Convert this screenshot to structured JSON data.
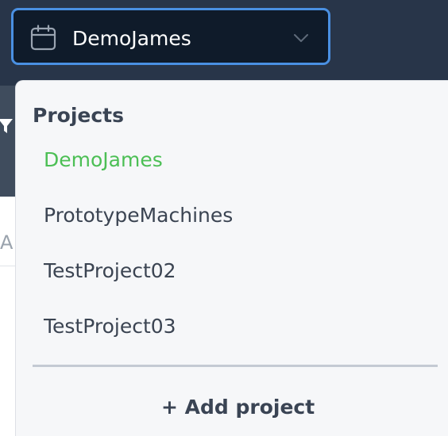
{
  "project_select": {
    "selected_value": "DemoJames",
    "icon": "calendar-icon",
    "chevron": "chevron-down-icon"
  },
  "background": {
    "letter_fragment": "A",
    "filter_icon": "filter-icon"
  },
  "dropdown": {
    "heading": "Projects",
    "items": [
      {
        "label": "DemoJames",
        "active": true
      },
      {
        "label": "PrototypeMachines",
        "active": false
      },
      {
        "label": "TestProject02",
        "active": false
      },
      {
        "label": "TestProject03",
        "active": false
      }
    ],
    "add_label": "+ Add project"
  },
  "colors": {
    "topbar": "#283549",
    "select_bg": "#0f1b2a",
    "select_border": "#4a90e2",
    "active_item": "#4cbf55",
    "dropdown_bg": "#f6f7f9"
  }
}
